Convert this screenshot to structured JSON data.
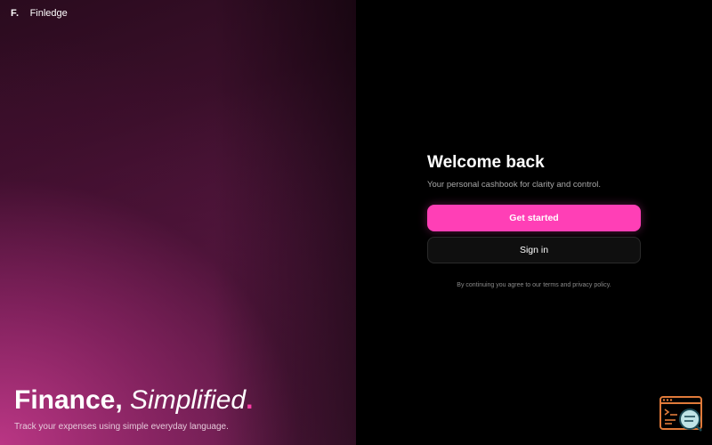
{
  "brand": {
    "logo": "F.",
    "name": "Finledge"
  },
  "hero": {
    "title_strong": "Finance,",
    "title_italic": "Simplified",
    "title_dot": ".",
    "subtitle": "Track your expenses using simple everyday language."
  },
  "auth": {
    "heading": "Welcome back",
    "tagline": "Your personal cashbook for clarity and control.",
    "primary_label": "Get started",
    "secondary_label": "Sign in",
    "legal": "By continuing you agree to our terms and privacy policy."
  },
  "colors": {
    "accent": "#ff3fb6",
    "background": "#000000",
    "widget": "#e07a3a"
  },
  "icons": [
    "code-window-icon"
  ]
}
